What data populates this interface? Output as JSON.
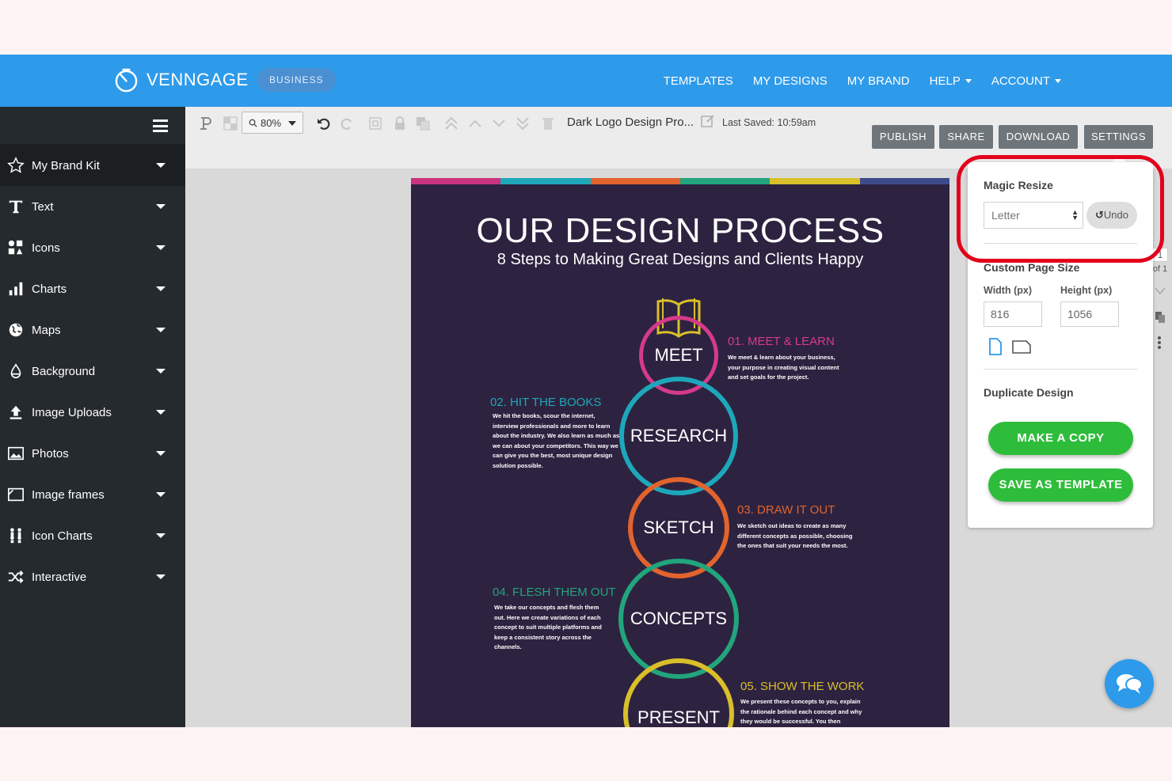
{
  "header": {
    "brand": "VENNGAGE",
    "plan_badge": "BUSINESS",
    "nav": [
      {
        "label": "TEMPLATES"
      },
      {
        "label": "MY DESIGNS"
      },
      {
        "label": "MY BRAND"
      },
      {
        "label": "HELP",
        "dropdown": true
      },
      {
        "label": "ACCOUNT",
        "dropdown": true
      }
    ],
    "color": "#2e9aea"
  },
  "sidebar": {
    "items": [
      {
        "label": "My Brand Kit",
        "icon": "star-icon"
      },
      {
        "label": "Text",
        "icon": "text-icon"
      },
      {
        "label": "Icons",
        "icon": "icons-grid-icon"
      },
      {
        "label": "Charts",
        "icon": "bar-chart-icon"
      },
      {
        "label": "Maps",
        "icon": "globe-icon"
      },
      {
        "label": "Background",
        "icon": "paint-drop-icon"
      },
      {
        "label": "Image Uploads",
        "icon": "upload-icon"
      },
      {
        "label": "Photos",
        "icon": "photo-icon"
      },
      {
        "label": "Image frames",
        "icon": "frame-icon"
      },
      {
        "label": "Icon Charts",
        "icon": "people-chart-icon"
      },
      {
        "label": "Interactive",
        "icon": "shuffle-icon"
      }
    ]
  },
  "toolbar": {
    "zoom": "80%",
    "doc_title": "Dark Logo Design Pro...",
    "last_saved": "Last Saved: 10:59am",
    "buttons": [
      "PUBLISH",
      "SHARE",
      "DOWNLOAD",
      "SETTINGS"
    ]
  },
  "poster": {
    "title": "OUR DESIGN PROCESS",
    "subtitle": "8 Steps to Making Great Designs and Clients Happy",
    "background": "#2d2340",
    "stripes": [
      "#c9337f",
      "#1ea7ba",
      "#e2632e",
      "#22a57c",
      "#d9bf2a",
      "#3d4b8c"
    ],
    "steps": [
      {
        "word": "MEET",
        "heading": "01. MEET & LEARN",
        "color": "#d63a8a",
        "body": [
          "We meet & learn about your business,",
          "your purpose in creating visual content",
          "and set goals for the project."
        ]
      },
      {
        "word": "RESEARCH",
        "heading": "02. HIT THE BOOKS",
        "color": "#1ea7ba",
        "body": [
          "We hit the books, scour the internet,",
          "interview professionals and more to learn",
          "about the industry. We also learn as much as",
          "we can about your competitors. This way we",
          "can give you the best, most unique design",
          "solution possible."
        ]
      },
      {
        "word": "SKETCH",
        "heading": "03. DRAW IT OUT",
        "color": "#e2632e",
        "body": [
          "We sketch out ideas to create as many",
          "different concepts as possible, choosing",
          "the ones that suit your needs the most."
        ]
      },
      {
        "word": "CONCEPTS",
        "heading": "04. FLESH THEM OUT",
        "color": "#22a57c",
        "body": [
          "We take our concepts and flesh them",
          "out. Here we create variations of each",
          "concept to suit multiple platforms and",
          "keep a consistent story across the",
          "channels."
        ]
      },
      {
        "word": "PRESENT",
        "heading": "05. SHOW THE WORK",
        "color": "#d9bf2a",
        "body": [
          "We present these concepts to you, explain",
          "the rationale behind each concept and why",
          "they would be successful. You then"
        ]
      }
    ]
  },
  "settings_panel": {
    "magic_resize_label": "Magic Resize",
    "size_select": "Letter",
    "undo_label": "Undo",
    "custom_size_label": "Custom Page Size",
    "width_label": "Width (px)",
    "height_label": "Height (px)",
    "width_value": "816",
    "height_value": "1056",
    "duplicate_label": "Duplicate Design",
    "make_copy": "MAKE A COPY",
    "save_template": "SAVE AS TEMPLATE",
    "accent": "#2ebd3a",
    "highlight_color": "#e3001b"
  },
  "page_indicator": {
    "current": "1",
    "total": "of 1"
  }
}
